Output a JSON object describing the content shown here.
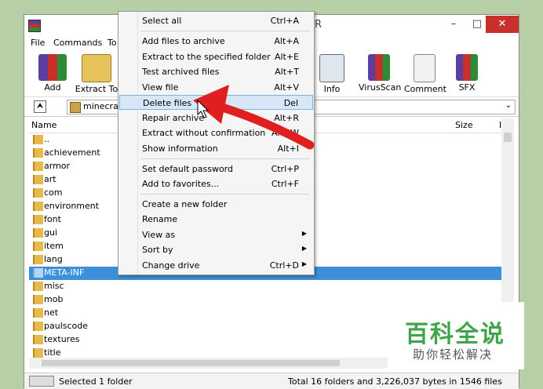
{
  "window": {
    "title_fragment": "R",
    "minimize": "–",
    "maximize": "□",
    "close": "✕"
  },
  "menubar": {
    "file": "File",
    "commands": "Commands",
    "tools_fragment": "To"
  },
  "toolbar": {
    "add": "Add",
    "extract": "Extract To",
    "info": "Info",
    "virusscan": "VirusScan",
    "comment": "Comment",
    "sfx": "SFX"
  },
  "path": {
    "up": "⮝",
    "value": "minecraf",
    "dropdown": "⌄"
  },
  "list": {
    "name_header": "Name",
    "size_header": "Size",
    "col3_fragment": "I",
    "rows": [
      "..",
      "achievement",
      "armor",
      "art",
      "com",
      "environment",
      "font",
      "gui",
      "item",
      "lang",
      "META-INF",
      "misc",
      "mob",
      "net",
      "paulscode",
      "textures",
      "title"
    ]
  },
  "status": {
    "left": "Selected 1 folder",
    "right": "Total 16 folders and 3,226,037 bytes in 1546 files"
  },
  "context_menu": {
    "items": [
      {
        "label": "Select all",
        "shortcut": "Ctrl+A"
      },
      {
        "label": "Add files to archive",
        "shortcut": "Alt+A"
      },
      {
        "label": "Extract to the specified folder",
        "shortcut": "Alt+E"
      },
      {
        "label": "Test archived files",
        "shortcut": "Alt+T"
      },
      {
        "label": "View file",
        "shortcut": "Alt+V"
      },
      {
        "label": "Delete files",
        "shortcut": "Del"
      },
      {
        "label": "Repair archive",
        "shortcut": "Alt+R"
      },
      {
        "label": "Extract without confirmation",
        "shortcut": "Alt+W"
      },
      {
        "label": "Show information",
        "shortcut": "Alt+I"
      },
      {
        "label": "Set default password",
        "shortcut": "Ctrl+P"
      },
      {
        "label": "Add to favorites...",
        "shortcut": "Ctrl+F"
      },
      {
        "label": "Create a new folder",
        "shortcut": ""
      },
      {
        "label": "Rename",
        "shortcut": ""
      },
      {
        "label": "View as",
        "shortcut": ""
      },
      {
        "label": "Sort by",
        "shortcut": ""
      },
      {
        "label": "Change drive",
        "shortcut": "Ctrl+D"
      }
    ]
  },
  "watermark": {
    "big": "百科全说",
    "small": "助你轻松解决"
  },
  "colors": {
    "selection": "#3c8fd8",
    "highlight": "#d6e8f7",
    "arrow": "#e02020",
    "close": "#c7302b"
  }
}
